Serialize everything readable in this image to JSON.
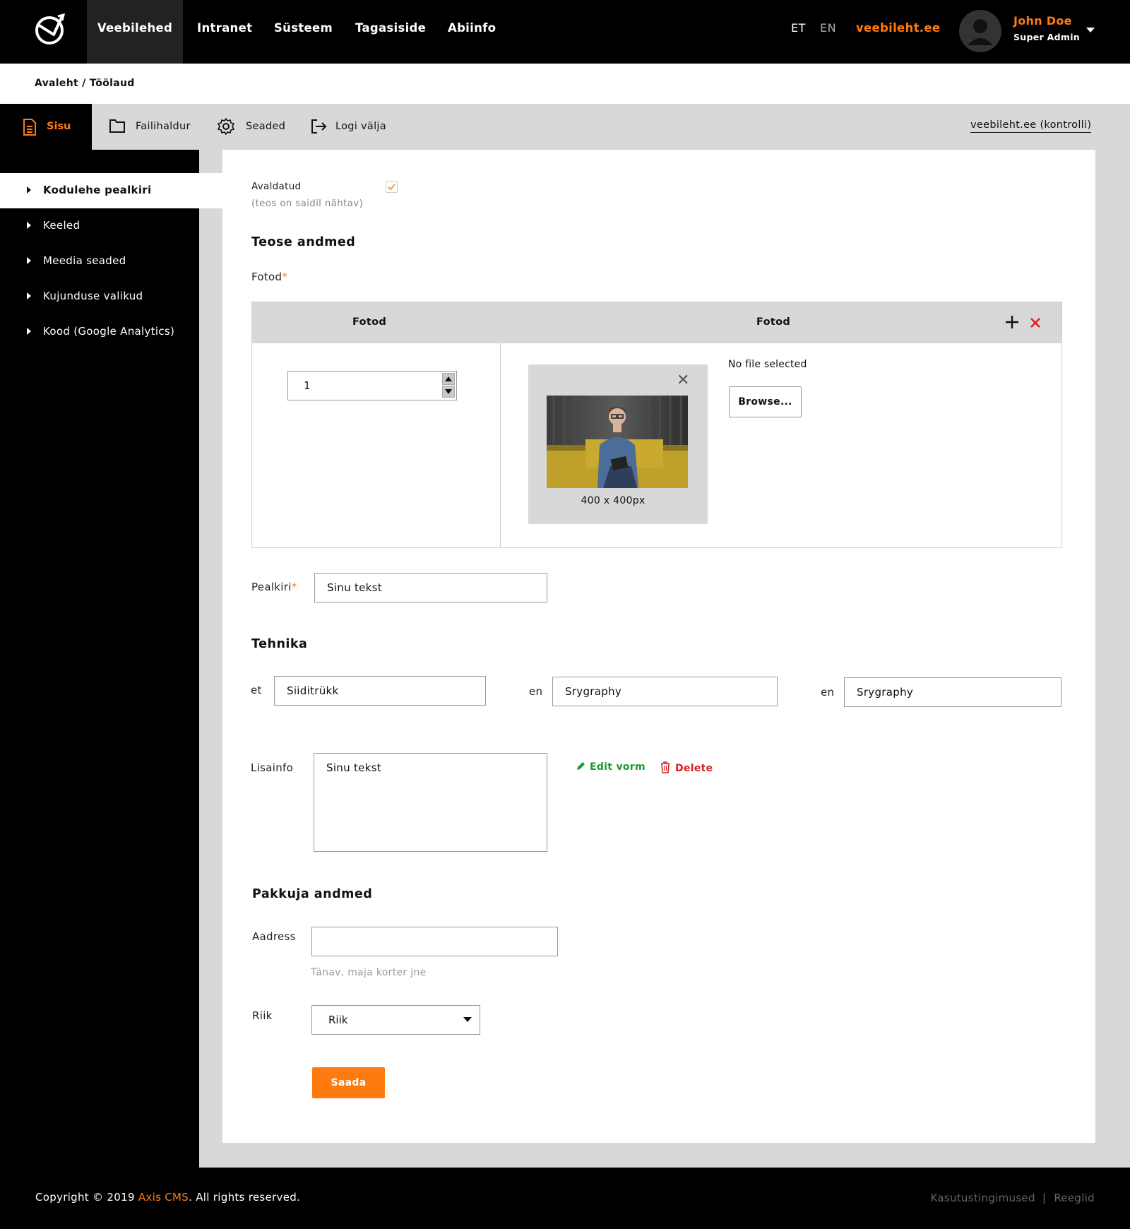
{
  "topnav": {
    "items": [
      {
        "label": "Veebilehed"
      },
      {
        "label": "Intranet"
      },
      {
        "label": "Süsteem"
      },
      {
        "label": "Tagasiside"
      },
      {
        "label": "Abiinfo"
      }
    ],
    "languages": [
      "ET",
      "EN"
    ],
    "active_language": "ET",
    "site_link": "veebileht.ee",
    "user": {
      "name": "John Doe",
      "role": "Super Admin"
    }
  },
  "breadcrumb": "Avaleht / Töölaud",
  "toolbar": {
    "sisu": "Sisu",
    "failihaldur": "Failihaldur",
    "seaded": "Seaded",
    "logout": "Logi välja",
    "kontrolli": "veebileht.ee (kontrolli)"
  },
  "sidebar": {
    "items": [
      {
        "label": "Kodulehe pealkiri"
      },
      {
        "label": "Keeled"
      },
      {
        "label": "Meedia seaded"
      },
      {
        "label": "Kujunduse valikud"
      },
      {
        "label": "Kood (Google Analytics)"
      }
    ]
  },
  "form": {
    "published_label": "Avaldatud",
    "published_hint": "(teos on saidil nähtav)",
    "published_checked": true,
    "section_work": "Teose andmed",
    "photos_label": "Fotod",
    "photos_table": {
      "col1": "Fotod",
      "col2": "Fotod",
      "order_value": "1",
      "photo_dims": "400 x 400px",
      "no_file": "No file selected",
      "browse": "Browse..."
    },
    "title_label": "Pealkiri",
    "title_value": "Sinu tekst",
    "section_technique": "Tehnika",
    "technique": [
      {
        "lang": "et",
        "value": "Siiditrükk"
      },
      {
        "lang": "en",
        "value": "Srygraphy"
      },
      {
        "lang": "en",
        "value": "Srygraphy"
      }
    ],
    "extra_label": "Lisainfo",
    "extra_value": "Sinu tekst",
    "edit_label": "Edit vorm",
    "delete_label": "Delete",
    "section_provider": "Pakkuja andmed",
    "address_label": "Aadress",
    "address_value": "",
    "address_hint": "Tänav, maja korter jne",
    "country_label": "Riik",
    "country_value": "Riik",
    "submit": "Saada"
  },
  "footer": {
    "copyright_prefix": "Copyright © 2019 ",
    "brand": "Axis CMS",
    "copyright_suffix": ". All rights reserved.",
    "terms": "Kasutustingimused",
    "separator": "|",
    "rules": "Reeglid"
  },
  "colors": {
    "accent": "#ff7b0f",
    "success": "#1a9b2d",
    "danger": "#d62020"
  }
}
